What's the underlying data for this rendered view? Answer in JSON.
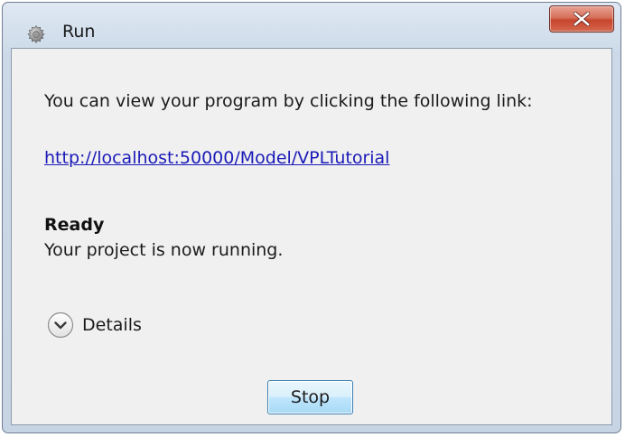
{
  "window": {
    "title": "Run",
    "icon": "gear-icon",
    "close_icon": "close-icon"
  },
  "content": {
    "message": "You can view your program by clicking the following link:",
    "link": "http://localhost:50000/Model/VPLTutorial",
    "status_title": "Ready",
    "status_text": "Your project is now running.",
    "details_label": "Details",
    "details_icon": "chevron-down-icon"
  },
  "buttons": {
    "stop_label": "Stop"
  },
  "colors": {
    "link": "#1a1ab8",
    "close_button": "#c7442c",
    "frame": "#cbd9e8",
    "dialog_background": "#f0f0f0",
    "stop_button_border": "#3c7fb1"
  }
}
